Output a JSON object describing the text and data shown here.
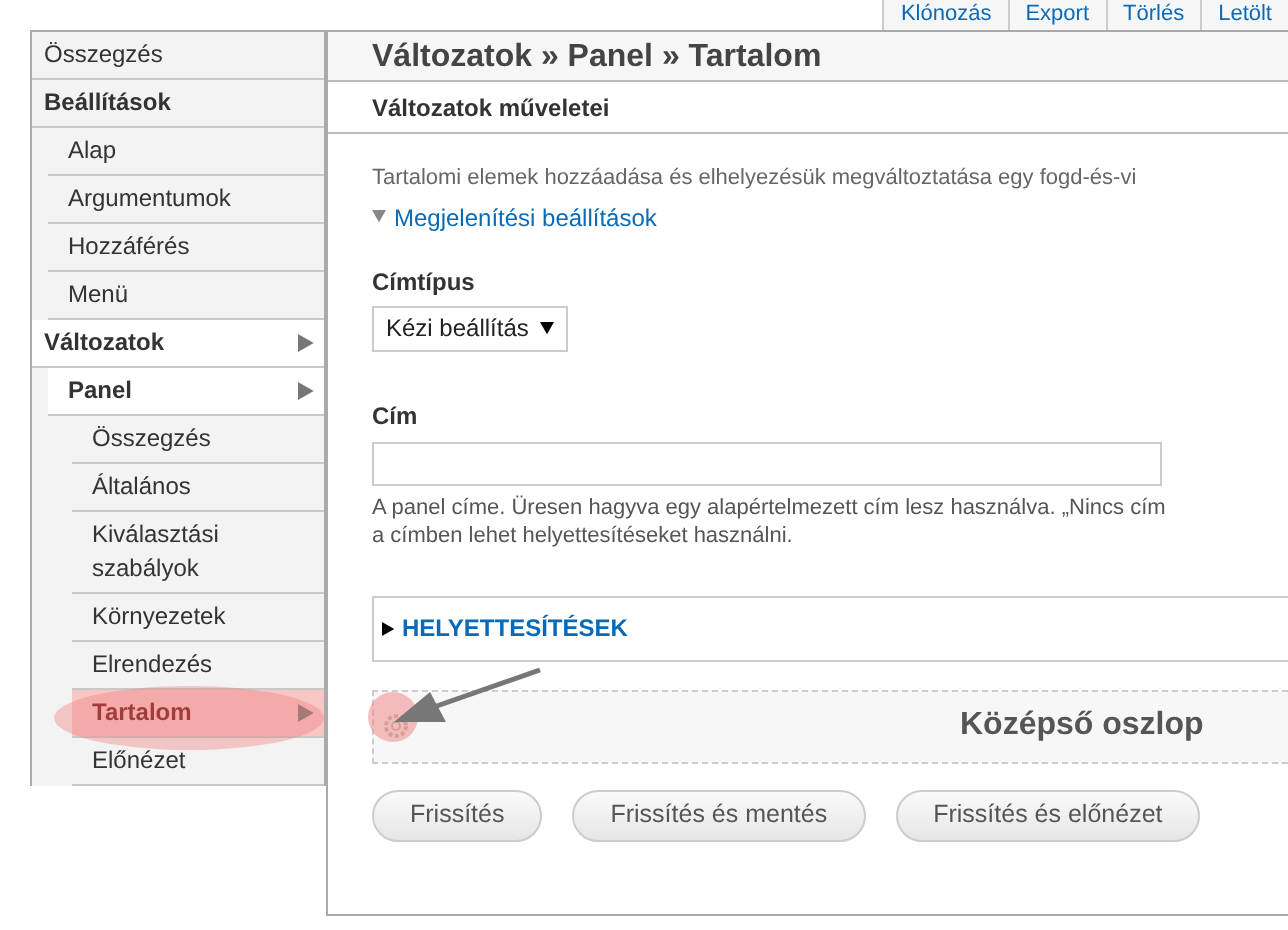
{
  "tabs": [
    {
      "label": "Klónozás"
    },
    {
      "label": "Export"
    },
    {
      "label": "Törlés"
    },
    {
      "label": "Letölt"
    }
  ],
  "sidebar": {
    "items": [
      {
        "label": "Összegzés",
        "selected": false,
        "active": false
      },
      {
        "label": "Beállítások",
        "selected": false,
        "active": false,
        "children": [
          {
            "label": "Alap",
            "selected": false,
            "active": false
          },
          {
            "label": "Argumentumok",
            "selected": false,
            "active": false
          },
          {
            "label": "Hozzáférés",
            "selected": false,
            "active": false
          },
          {
            "label": "Menü",
            "selected": false,
            "active": false
          }
        ]
      },
      {
        "label": "Változatok",
        "selected": false,
        "active": true,
        "children": [
          {
            "label": "Panel",
            "selected": false,
            "active": true,
            "children": [
              {
                "label": "Összegzés",
                "selected": false,
                "active": false
              },
              {
                "label": "Általános",
                "selected": false,
                "active": false
              },
              {
                "label": "Kiválasztási szabályok",
                "selected": false,
                "active": false
              },
              {
                "label": "Környezetek",
                "selected": false,
                "active": false
              },
              {
                "label": "Elrendezés",
                "selected": false,
                "active": false
              },
              {
                "label": "Tartalom",
                "selected": true,
                "active": true
              },
              {
                "label": "Előnézet",
                "selected": false,
                "active": false
              }
            ]
          }
        ]
      }
    ]
  },
  "page_title": "Változatok » Panel » Tartalom",
  "section_title": "Változatok műveletei",
  "description": "Tartalomi elemek hozzáadása és elhelyezésük megváltoztatása egy fogd-és-vi",
  "display_settings_link": {
    "label": "Megjelenítési beállítások",
    "expanded": true
  },
  "title_type": {
    "label": "Címtípus",
    "value": "Kézi beállítás"
  },
  "title_field": {
    "label": "Cím",
    "help_lines": [
      "A panel címe. Üresen hagyva egy alapértelmezett cím lesz használva. „Nincs cím",
      "a címben lehet helyettesítéseket használni."
    ]
  },
  "substitutions": {
    "label": "HELYETTESÍTÉSEK",
    "expanded": false
  },
  "region": {
    "label": "Középső oszlop"
  },
  "buttons": [
    "Frissítés",
    "Frissítés és mentés",
    "Frissítés és előnézet"
  ]
}
